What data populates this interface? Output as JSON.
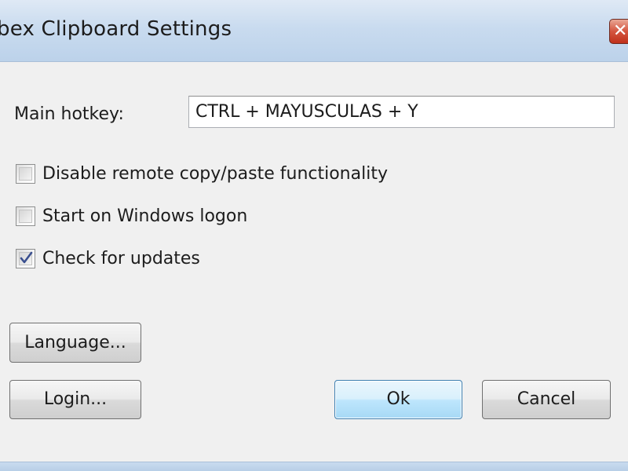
{
  "window": {
    "title": "bex Clipboard Settings",
    "close_glyph": "✕"
  },
  "hotkey": {
    "label": "Main hotkey:",
    "value": "CTRL + MAYUSCULAS + Y"
  },
  "options": [
    {
      "label": "Disable remote copy/paste functionality",
      "checked": false
    },
    {
      "label": "Start on Windows logon",
      "checked": false
    },
    {
      "label": "Check for updates",
      "checked": true
    }
  ],
  "buttons": {
    "language": "Language...",
    "login": "Login...",
    "ok": "Ok",
    "cancel": "Cancel"
  },
  "colors": {
    "titlebar": "#c9dbef",
    "client": "#f0f0f0",
    "close_button": "#c0311b",
    "default_button_border": "#3c7fb1"
  }
}
